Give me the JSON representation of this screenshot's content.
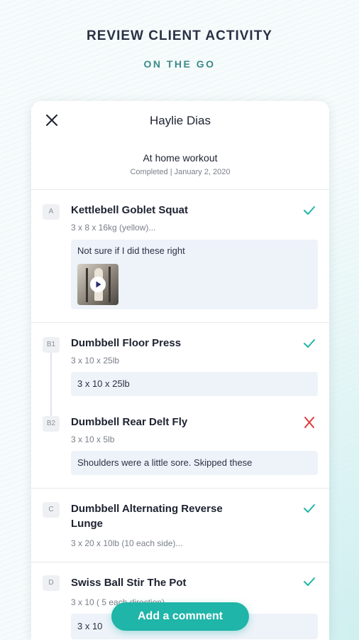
{
  "hero": {
    "title": "REVIEW CLIENT ACTIVITY",
    "subtitle": "ON THE GO"
  },
  "header": {
    "client_name": "Haylie Dias",
    "workout_name": "At home workout",
    "workout_meta": "Completed | January 2, 2020",
    "close_icon": "close-icon"
  },
  "colors": {
    "accent": "#1fb5a8",
    "check": "#1fb5a8",
    "cross": "#e03a3a",
    "note_bg": "#eef2f9"
  },
  "sections": [
    {
      "badge": "A",
      "exercises": [
        {
          "title": "Kettlebell Goblet Squat",
          "detail": "3 x 8 x 16kg (yellow)...",
          "note": "Not sure if I did these right",
          "has_video": true,
          "status": "check-icon"
        }
      ]
    },
    {
      "exercises": [
        {
          "badge": "B1",
          "title": "Dumbbell Floor Press",
          "detail": "3 x 10 x 25lb",
          "note": "3 x 10 x 25lb",
          "status": "check-icon"
        },
        {
          "badge": "B2",
          "title": "Dumbbell Rear Delt Fly",
          "detail": "3 x 10 x 5lb",
          "note": "Shoulders were a little sore. Skipped these",
          "status": "cross-icon"
        }
      ]
    },
    {
      "badge": "C",
      "exercises": [
        {
          "title": "Dumbbell Alternating  Reverse Lunge",
          "detail": "3 x 20 x 10lb (10 each side)...",
          "status": "check-icon"
        }
      ]
    },
    {
      "badge": "D",
      "exercises": [
        {
          "title": "Swiss Ball Stir The Pot",
          "detail": "3 x 10 ( 5 each direction)",
          "note": "3 x 10",
          "status": "check-icon"
        }
      ]
    }
  ],
  "footer": {
    "add_comment_label": "Add a comment"
  }
}
